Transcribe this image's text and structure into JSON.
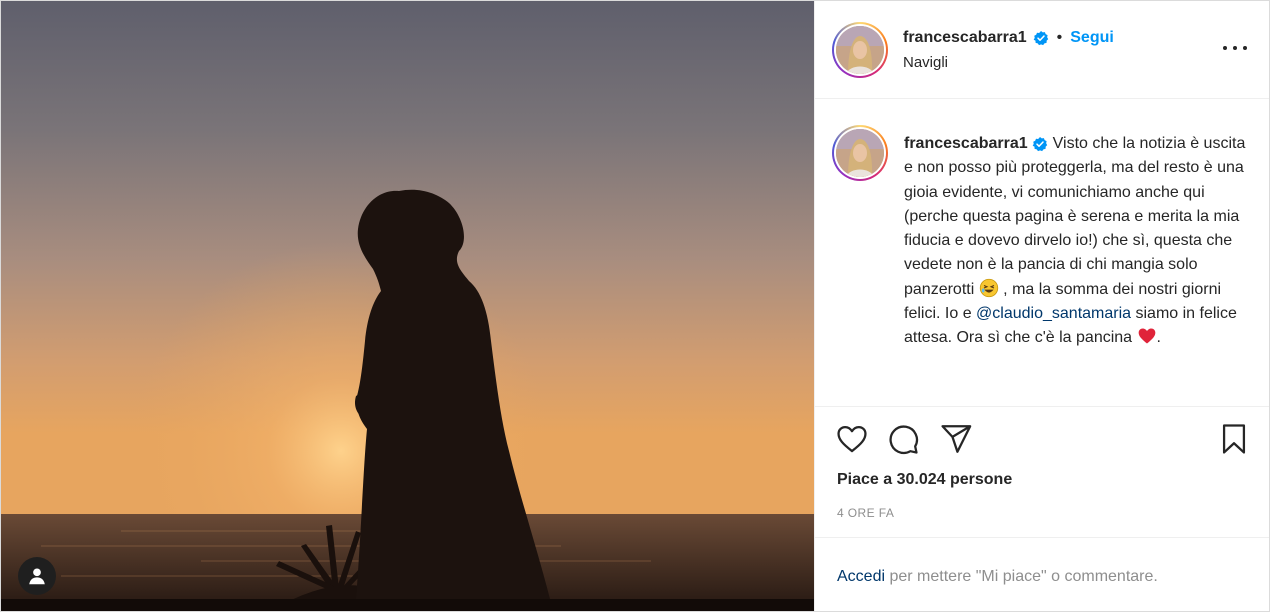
{
  "author": {
    "username": "francescabarra1",
    "location": "Navigli",
    "follow_label": "Segui",
    "separator": "•"
  },
  "caption": {
    "username": "francescabarra1",
    "part1": "Visto che la notizia è uscita e non posso più proteggerla, ma del resto è una gioia evidente, vi comunichiamo anche qui (perche questa pagina è serena e merita la mia fiducia e dovevo dirvelo io!) che sì, questa che vedete non è la pancia di chi mangia solo panzerotti",
    "part2": ", ma la somma dei nostri giorni felici. Io e",
    "mention": "@claudio_santamaria",
    "part3": "siamo in felice attesa. Ora sì che c'è la pancina",
    "part4": "."
  },
  "stats": {
    "likes": "Piace a 30.024 persone",
    "time": "4 ORE FA"
  },
  "login": {
    "link": "Accedi",
    "rest": "per mettere \"Mi piace\" o commentare."
  },
  "icons": [
    "user-tag-icon",
    "verified-icon",
    "more-options-icon",
    "heart-icon",
    "comment-icon",
    "share-icon",
    "save-icon",
    "laughing-emoji-icon",
    "red-heart-emoji-icon"
  ],
  "colors": {
    "link_blue": "#0095f6",
    "mention_blue": "#00376b",
    "muted": "#8e8e8e",
    "text": "#262626"
  }
}
